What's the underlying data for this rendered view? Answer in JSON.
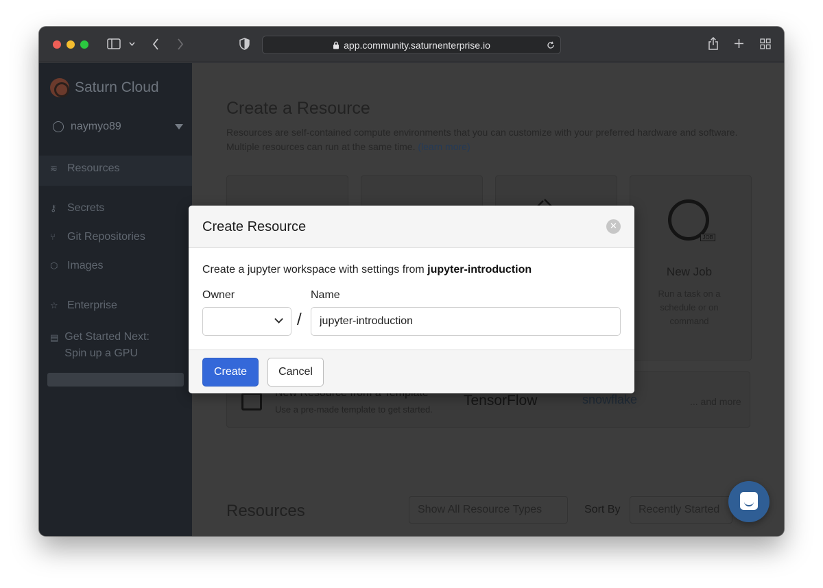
{
  "browser": {
    "url": "app.community.saturnenterprise.io"
  },
  "sidebar": {
    "brand": "Saturn Cloud",
    "username": "naymyo89",
    "items": [
      {
        "label": "Resources",
        "icon": "layers-icon"
      },
      {
        "label": "Secrets",
        "icon": "key-icon"
      },
      {
        "label": "Git Repositories",
        "icon": "git-branch-icon"
      },
      {
        "label": "Images",
        "icon": "cube-icon"
      },
      {
        "label": "Enterprise",
        "icon": "star-icon"
      },
      {
        "label": "Get Started Next: Spin up a GPU",
        "icon": "gpu-icon"
      }
    ]
  },
  "main": {
    "title": "Create a Resource",
    "description": "Resources are self-contained compute environments that you can customize with your preferred hardware and software. Multiple resources can run at the same time.",
    "learn_more": "(learn more)",
    "job_card": {
      "title": "New Job",
      "description": "Run a task on a schedule or on command"
    },
    "template_card": {
      "title": "New Resource from a Template",
      "subtitle": "Use a pre-made template to get started.",
      "logo_tensorflow": "TensorFlow",
      "logo_snowflake": "snowflake",
      "more": "... and more"
    },
    "resources_section": {
      "title": "Resources",
      "filter": "Show All Resource Types",
      "sort_label": "Sort By",
      "sort_value": "Recently Started"
    }
  },
  "modal": {
    "title": "Create Resource",
    "text_prefix": "Create a jupyter workspace with settings from ",
    "text_bold": "jupyter-introduction",
    "owner_label": "Owner",
    "owner_value": "",
    "separator": "/",
    "name_label": "Name",
    "name_value": "jupyter-introduction",
    "create_label": "Create",
    "cancel_label": "Cancel"
  }
}
